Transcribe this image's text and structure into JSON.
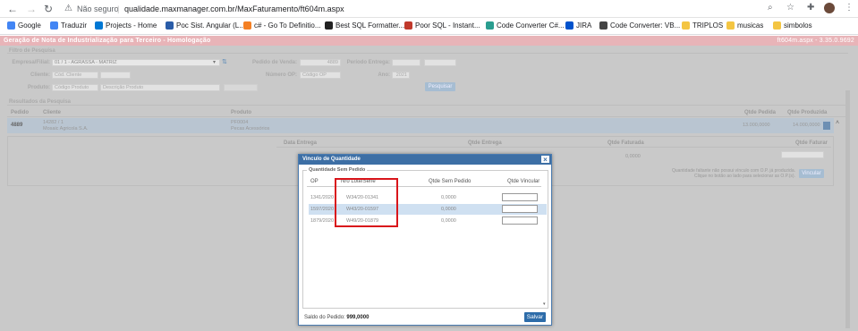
{
  "browser": {
    "back": "←",
    "forward": "→",
    "reload": "↻",
    "security": "Não seguro",
    "url": "qualidade.maxmanager.com.br/MaxFaturamento/ft604m.aspx"
  },
  "bookmarks": [
    {
      "label": "Google",
      "icon": "google-icon",
      "color": "#4285f4"
    },
    {
      "label": "Traduzir",
      "icon": "translate-icon",
      "color": "#4285f4"
    },
    {
      "label": "Projects - Home",
      "icon": "azure-devops-icon",
      "color": "#0078d4"
    },
    {
      "label": "Poc Sist. Angular (L...",
      "icon": "doc-icon",
      "color": "#2a5ca8"
    },
    {
      "label": "c# - Go To Definitio...",
      "icon": "stackoverflow-icon",
      "color": "#f48024"
    },
    {
      "label": "Best SQL Formatter...",
      "icon": "cb-icon",
      "color": "#222222"
    },
    {
      "label": "Poor SQL - Instant...",
      "icon": "poorsql-icon",
      "color": "#c0392b"
    },
    {
      "label": "Code Converter C#...",
      "icon": "gear-icon",
      "color": "#2a9d8f"
    },
    {
      "label": "JIRA",
      "icon": "jira-icon",
      "color": "#0052cc"
    },
    {
      "label": "Code Converter: VB...",
      "icon": "globe-icon",
      "color": "#444444"
    },
    {
      "label": "TRIPLOS",
      "icon": "folder-icon",
      "color": "#f4c542"
    },
    {
      "label": "musicas",
      "icon": "folder-icon",
      "color": "#f4c542"
    },
    {
      "label": "simbolos",
      "icon": "folder-icon",
      "color": "#f4c542"
    }
  ],
  "app": {
    "title": "Geração de Nota de Industrialização para Terceiro - Homologação",
    "version": "ft604m.aspx - 3.35.0.9692",
    "filters": {
      "section": "Filtro de Pesquisa",
      "empresa_label": "Empresa/Filial:",
      "empresa_value": "01 / 1 - AGRASSA - MATRIZ",
      "cliente_label": "Cliente:",
      "cliente_placeholder": "Cód. Cliente",
      "produto_label": "Produto:",
      "produto_code": "Código Produto",
      "produto_desc": "Descrição Produto",
      "pedido_label": "Pedido de Venda:",
      "pedido_value": "4889",
      "periodo_label": "Período Entrega:",
      "numero_op_label": "Número OP:",
      "numero_op_placeholder": "Código OP",
      "ano_label": "Ano:",
      "ano_value": "2021",
      "search_button": "Pesquisar"
    },
    "results": {
      "section": "Resultados da Pesquisa",
      "headers": [
        "Pedido",
        "Cliente",
        "Produto",
        "Qtde Pedida",
        "Qtde Produzida"
      ],
      "row": {
        "pedido": "4889",
        "cliente": "14282 / 1",
        "cliente_nome": "Mosaic Agricola S.A.",
        "produto": "PF0004",
        "produto_nome": "Pecas Acessórios",
        "qtde_pedida": "13.000,0000",
        "qtde_produzida": "14.000,0000"
      },
      "subheaders": [
        "Data Entrega",
        "Qtde Entrega",
        "Qtde Faturada",
        "Qtde Faturar"
      ],
      "sub_value": "0,0000",
      "hint": "Quantidade faltante não possui vínculo com O.P. já produzida. Clique no botão ao lado para selecionar as O.P.(s).",
      "vincular_button": "Vincular"
    },
    "modal": {
      "title": "Vinculo de Quantidade",
      "close": "×",
      "legend": "Quantidade Sem Pedido",
      "headers": {
        "op": "OP",
        "lote": "Nro Lote/Série",
        "qtde_sem_pedido": "Qtde Sem Pedido",
        "qtde_vincular": "Qtde Vincular"
      },
      "rows": [
        {
          "op": "1341/2020",
          "lote": "W34/20-01341",
          "qtde": "0,0000",
          "vincular": ""
        },
        {
          "op": "1597/2020",
          "lote": "W43/20-01597",
          "qtde": "0,0000",
          "vincular": ""
        },
        {
          "op": "1879/2020",
          "lote": "W49/20-01879",
          "qtde": "0,0000",
          "vincular": ""
        }
      ],
      "saldo_label": "Saldo do Pedido:",
      "saldo_value": "999,0000",
      "save_button": "Salvar"
    }
  }
}
